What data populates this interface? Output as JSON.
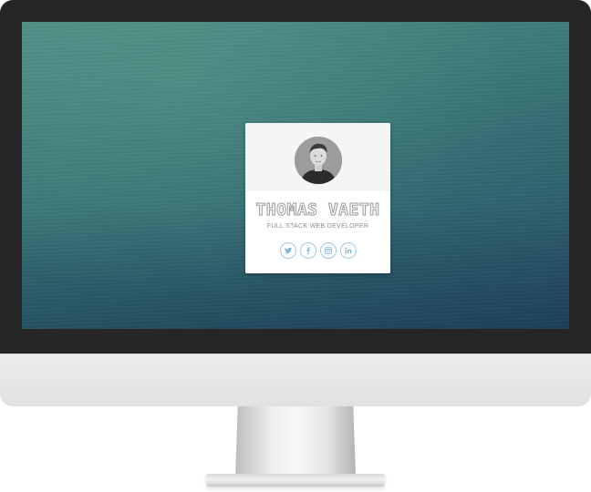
{
  "profile": {
    "name": "THOMAS VAETH",
    "subtitle": "FULL STACK WEB DEVELOPER",
    "avatar_icon": "person-portrait"
  },
  "social_links": [
    {
      "id": "twitter",
      "icon": "twitter-icon"
    },
    {
      "id": "facebook",
      "icon": "facebook-icon"
    },
    {
      "id": "instagram",
      "icon": "instagram-icon"
    },
    {
      "id": "linkedin",
      "icon": "linkedin-icon"
    }
  ],
  "colors": {
    "bezel": "#262626",
    "chin": "#e5e5e5",
    "social_accent": "#7fb6dc",
    "background_top": "#4c8f87",
    "background_bottom": "#244a64"
  }
}
